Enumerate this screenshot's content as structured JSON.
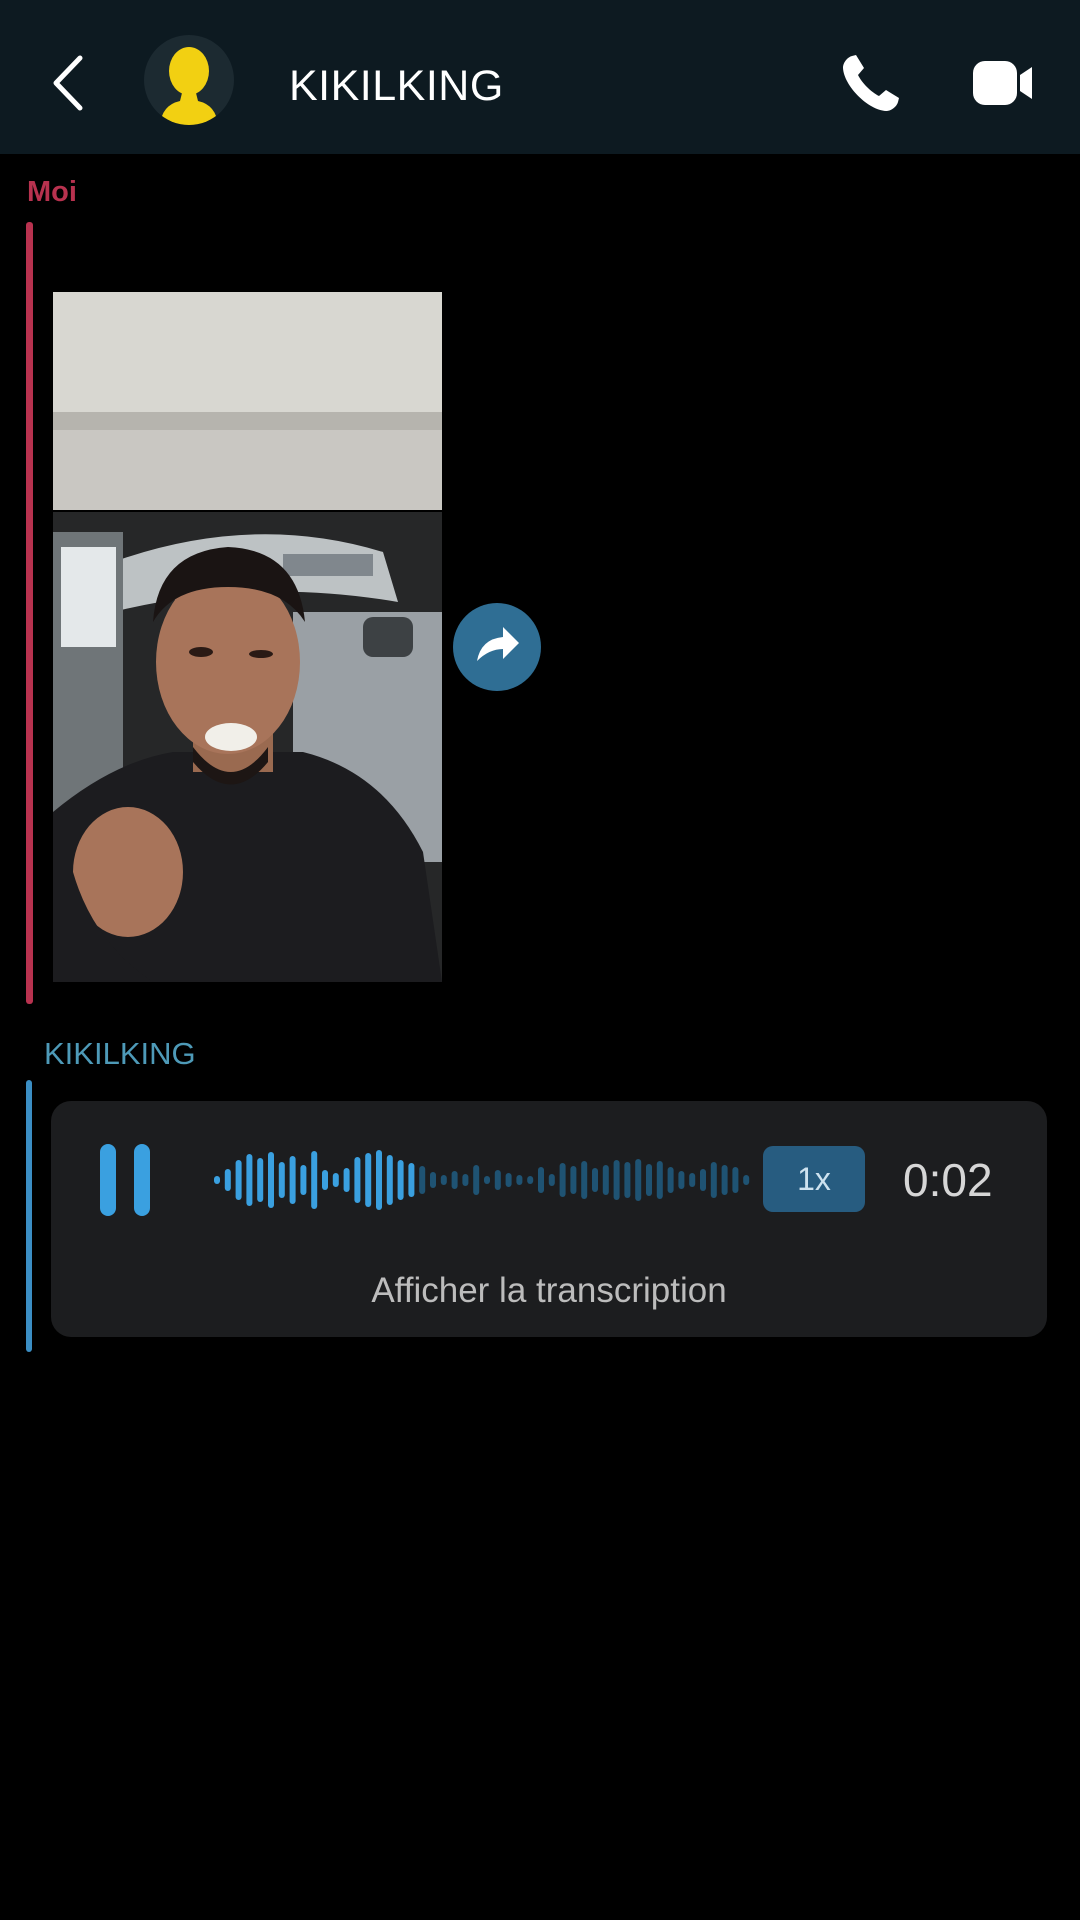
{
  "header": {
    "contact_name": "KIKILKING",
    "back_icon": "chevron-left-icon",
    "avatar_icon": "bitmoji-avatar-icon",
    "call_icon": "phone-icon",
    "video_icon": "video-camera-icon"
  },
  "messages": [
    {
      "sender": "Moi",
      "sender_color": "#b8324f",
      "type": "image",
      "image_description_icon": "photo-thumbnail",
      "share_icon": "share-arrow-icon"
    },
    {
      "sender": "KIKILKING",
      "sender_color": "#4e9ab8",
      "type": "voice_note",
      "playback_state_icon": "pause-icon",
      "speed_label": "1x",
      "duration": "0:02",
      "transcript_label": "Afficher la transcription",
      "played_fraction": 0.38
    }
  ],
  "colors": {
    "header_bg": "#0d1a21",
    "accent_blue": "#3aa0e0",
    "me_red": "#b8324f"
  }
}
